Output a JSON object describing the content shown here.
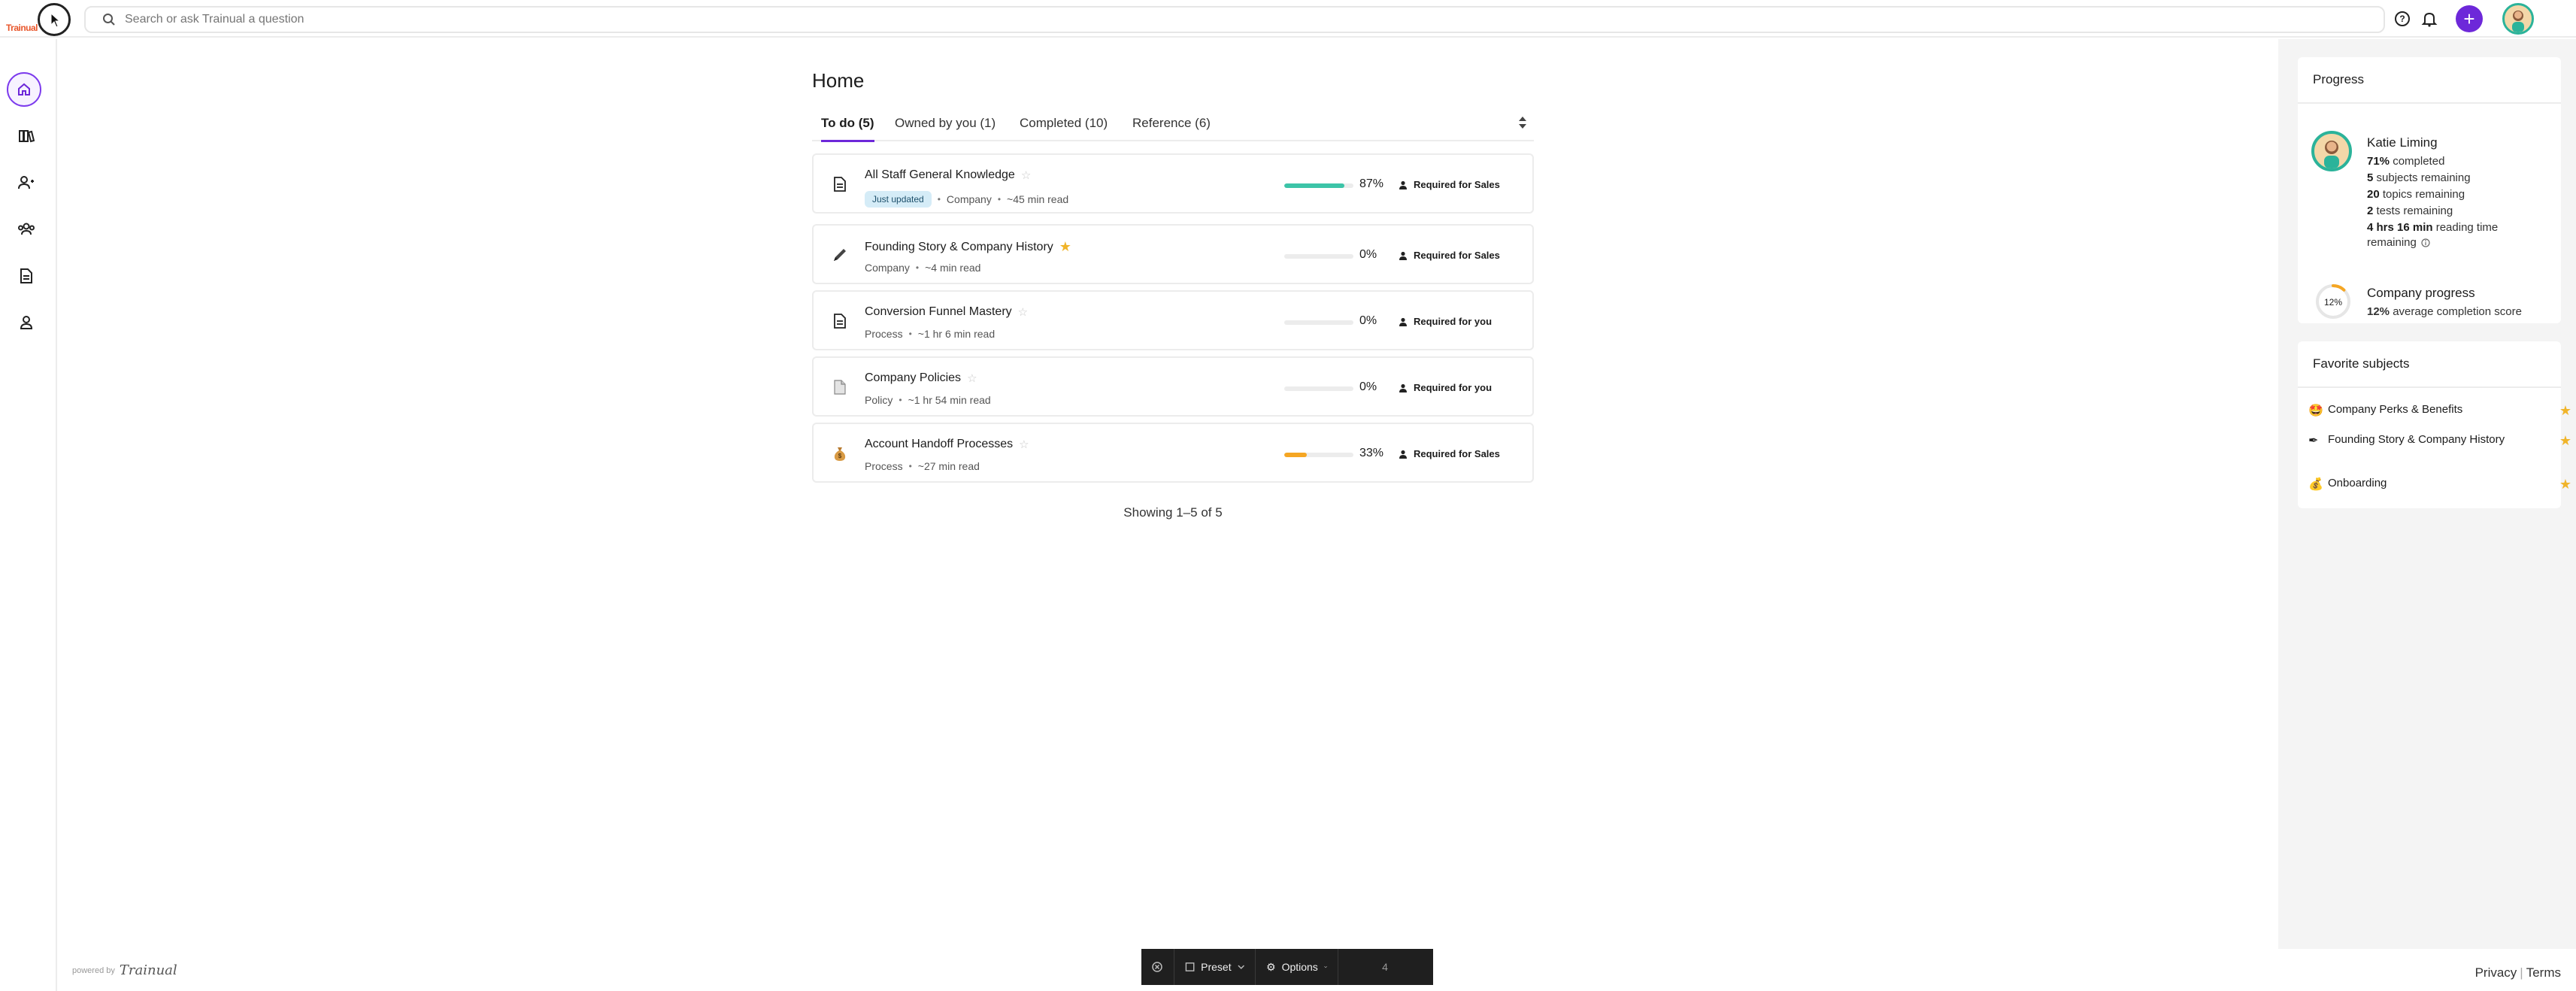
{
  "app": {
    "logo_text": "Trainual",
    "search_placeholder": "Search or ask Trainual a question",
    "plus_label": "+"
  },
  "main": {
    "title": "Home",
    "tabs": [
      {
        "label": "To do (5)",
        "active": true
      },
      {
        "label": "Owned by you (1)",
        "active": false
      },
      {
        "label": "Completed (10)",
        "active": false
      },
      {
        "label": "Reference (6)",
        "active": false
      }
    ],
    "items": [
      {
        "title": "All Staff General Knowledge",
        "favorite": false,
        "badge": "Just updated",
        "type": "Company",
        "read": "~45 min read",
        "progress": 87,
        "progress_label": "87%",
        "progress_color": "#3cc4a8",
        "required": "Required for Sales",
        "icon": "document-icon"
      },
      {
        "title": "Founding Story & Company History",
        "favorite": true,
        "badge": "",
        "type": "Company",
        "read": "~4 min read",
        "progress": 0,
        "progress_label": "0%",
        "progress_color": "#cfcfcf",
        "required": "Required for Sales",
        "icon": "pencil-icon"
      },
      {
        "title": "Conversion Funnel Mastery",
        "favorite": false,
        "badge": "",
        "type": "Process",
        "read": "~1 hr 6 min read",
        "progress": 0,
        "progress_label": "0%",
        "progress_color": "#cfcfcf",
        "required": "Required for you",
        "icon": "document-icon"
      },
      {
        "title": "Company Policies",
        "favorite": false,
        "badge": "",
        "type": "Policy",
        "read": "~1 hr 54 min read",
        "progress": 0,
        "progress_label": "0%",
        "progress_color": "#cfcfcf",
        "required": "Required for you",
        "icon": "page-icon"
      },
      {
        "title": "Account Handoff Processes",
        "favorite": false,
        "badge": "",
        "type": "Process",
        "read": "~27 min read",
        "progress": 33,
        "progress_label": "33%",
        "progress_color": "#f5a623",
        "required": "Required for Sales",
        "icon": "money-bag-icon"
      }
    ],
    "showing": "Showing 1–5 of 5"
  },
  "progress_panel": {
    "title": "Progress",
    "user_name": "Katie Liming",
    "stats": [
      {
        "value": "71%",
        "label": " completed"
      },
      {
        "value": "5",
        "label": " subjects remaining"
      },
      {
        "value": "20",
        "label": " topics remaining"
      },
      {
        "value": "2",
        "label": " tests remaining"
      },
      {
        "value": "4 hrs 16 min",
        "label": " reading time"
      }
    ],
    "remaining_label": "remaining",
    "company_title": "Company progress",
    "company_pct": "12%",
    "company_value": 12,
    "company_sub": " average completion score"
  },
  "favorites_panel": {
    "title": "Favorite subjects",
    "items": [
      {
        "label": "Company Perks & Benefits",
        "emoji": "🤩"
      },
      {
        "label": "Founding Story & Company History",
        "emoji": "✒"
      },
      {
        "label": "Onboarding",
        "emoji": "💰"
      }
    ]
  },
  "footer": {
    "powered_by": "powered by",
    "brand": "Trainual",
    "privacy": "Privacy",
    "separator": "|",
    "terms": "Terms"
  },
  "toolbar": {
    "preset": "Preset",
    "options": "Options",
    "count": "4"
  },
  "colors": {
    "accent": "#6d28d9",
    "teal": "#3cc4a8",
    "orange": "#f5a623",
    "star": "#f0b429"
  }
}
